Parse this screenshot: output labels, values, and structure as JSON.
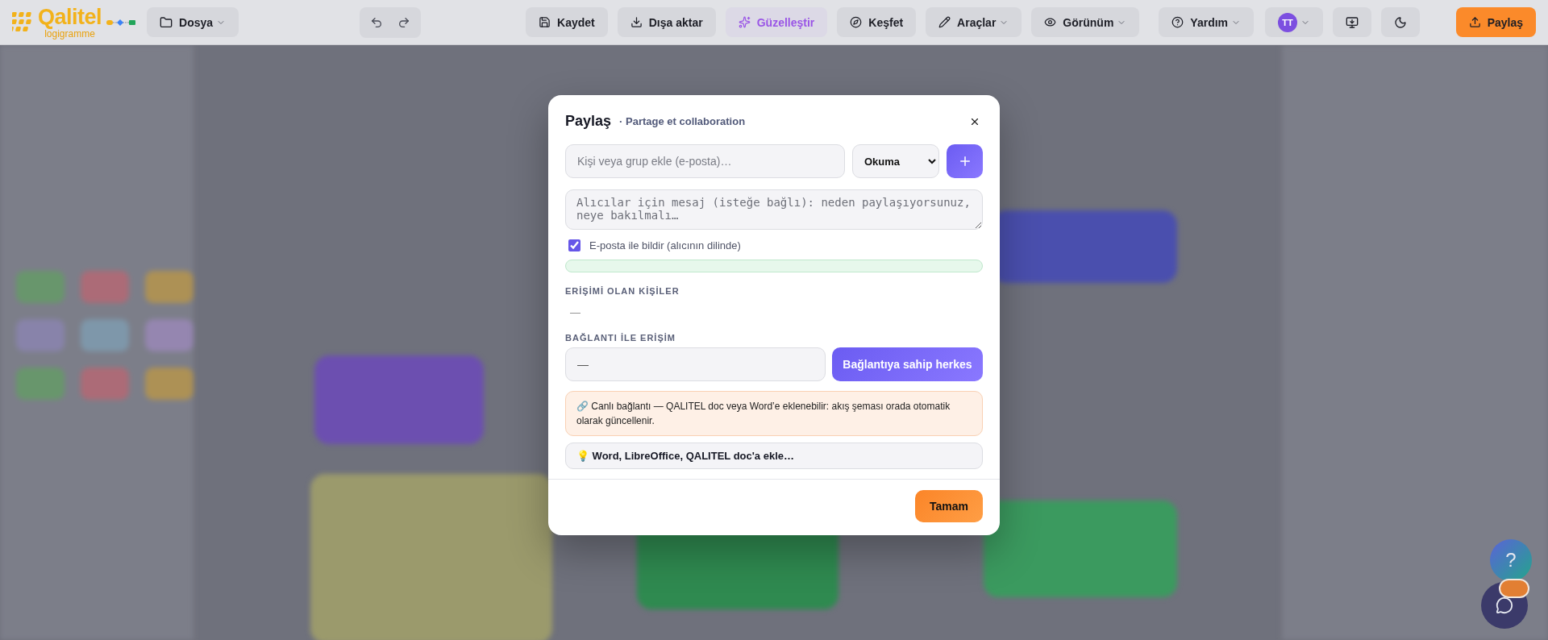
{
  "app_bar": {
    "logo": {
      "name": "Qalitel",
      "subtitle": "logigramme"
    },
    "file_menu": {
      "label": "Dosya",
      "has_menu": true
    },
    "history": [
      {
        "kind": "undo"
      },
      {
        "kind": "redo"
      }
    ],
    "actions": [
      {
        "kind": "save",
        "label": "Kaydet",
        "has_menu": false,
        "accent": false
      },
      {
        "kind": "export",
        "label": "Dışa aktar",
        "has_menu": false,
        "accent": false
      },
      {
        "kind": "beautify",
        "label": "Güzelleştir",
        "has_menu": false,
        "accent": true
      },
      {
        "kind": "explore",
        "label": "Keşfet",
        "has_menu": false,
        "accent": false
      },
      {
        "kind": "tools",
        "label": "Araçlar",
        "has_menu": true,
        "accent": false
      },
      {
        "kind": "view",
        "label": "Görünüm",
        "has_menu": true,
        "accent": false
      }
    ],
    "help": {
      "label": "Yardım",
      "has_menu": true
    },
    "user": {
      "initials": "TT",
      "has_menu": true
    },
    "share": {
      "label": "Paylaş"
    }
  },
  "floating": {
    "help": "?"
  },
  "share_dialog": {
    "title": "Paylaş",
    "subtitle": "· Partage et collaboration",
    "invite": {
      "placeholder": "Kişi veya grup ekle (e-posta)…",
      "role": "Okuma"
    },
    "message": {
      "placeholder": "Alıcılar için mesaj (isteğe bağlı): neden paylaşıyorsunuz, neye bakılmalı…"
    },
    "notify": {
      "label": "E-posta ile bildir (alıcının dilinde)",
      "checked": true
    },
    "people": {
      "heading": "ERİŞİMİ OLAN KİŞİLER",
      "empty": "—"
    },
    "link": {
      "heading": "BAĞLANTI İLE ERİŞİM",
      "value": "—",
      "scope": "Bağlantıya sahip herkes"
    },
    "info": "🔗 Canlı bağlantı — QALITEL doc veya Word’e eklenebilir: akış şeması orada otomatik olarak güncellenir.",
    "tip": "💡 Word, LibreOffice, QALITEL doc'a ekle…",
    "ok": "Tamam"
  }
}
